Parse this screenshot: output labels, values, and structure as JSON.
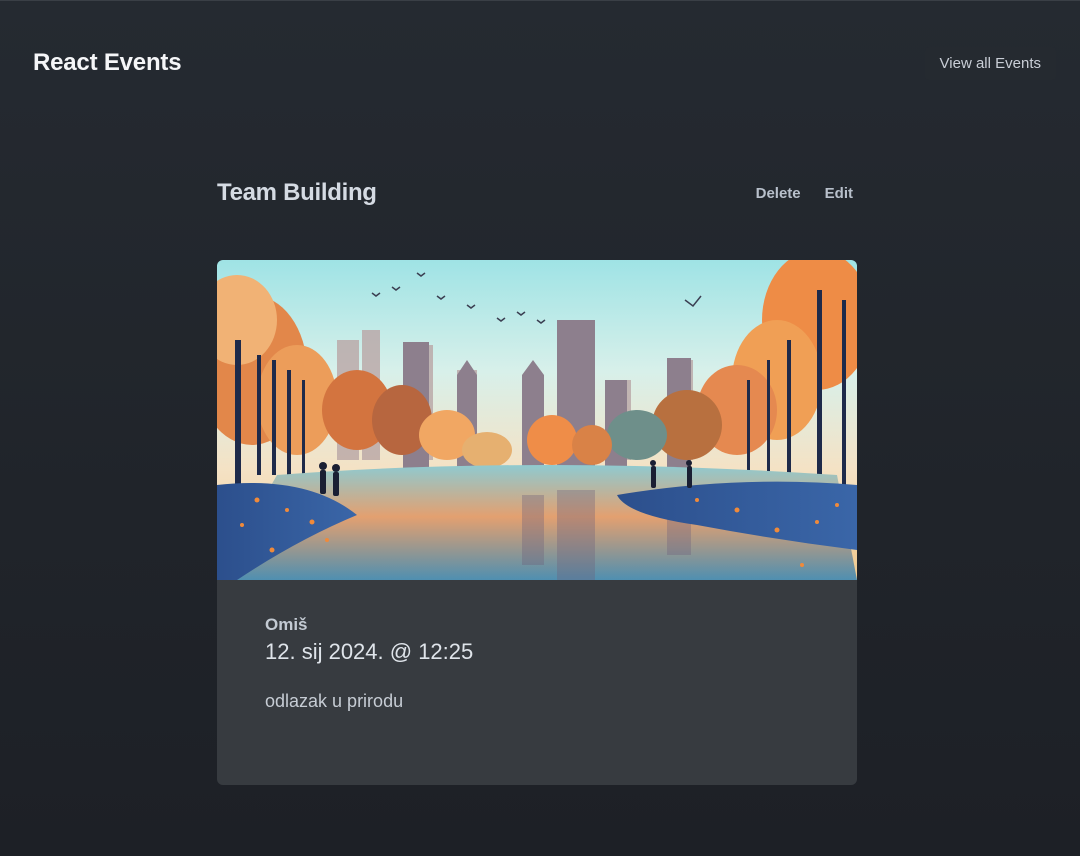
{
  "header": {
    "brand": "React Events",
    "view_all_label": "View all Events"
  },
  "event": {
    "title": "Team Building",
    "delete_label": "Delete",
    "edit_label": "Edit",
    "location": "Omiš",
    "datetime": "12. sij 2024. @ 12:25",
    "description": "odlazak u prirodu",
    "image_description_icon": "autumn-park-city-illustration"
  },
  "colors": {
    "background": "#20242a",
    "card": "#373b40",
    "text_primary": "#f5f6f8",
    "text_secondary": "#c3cad3"
  }
}
